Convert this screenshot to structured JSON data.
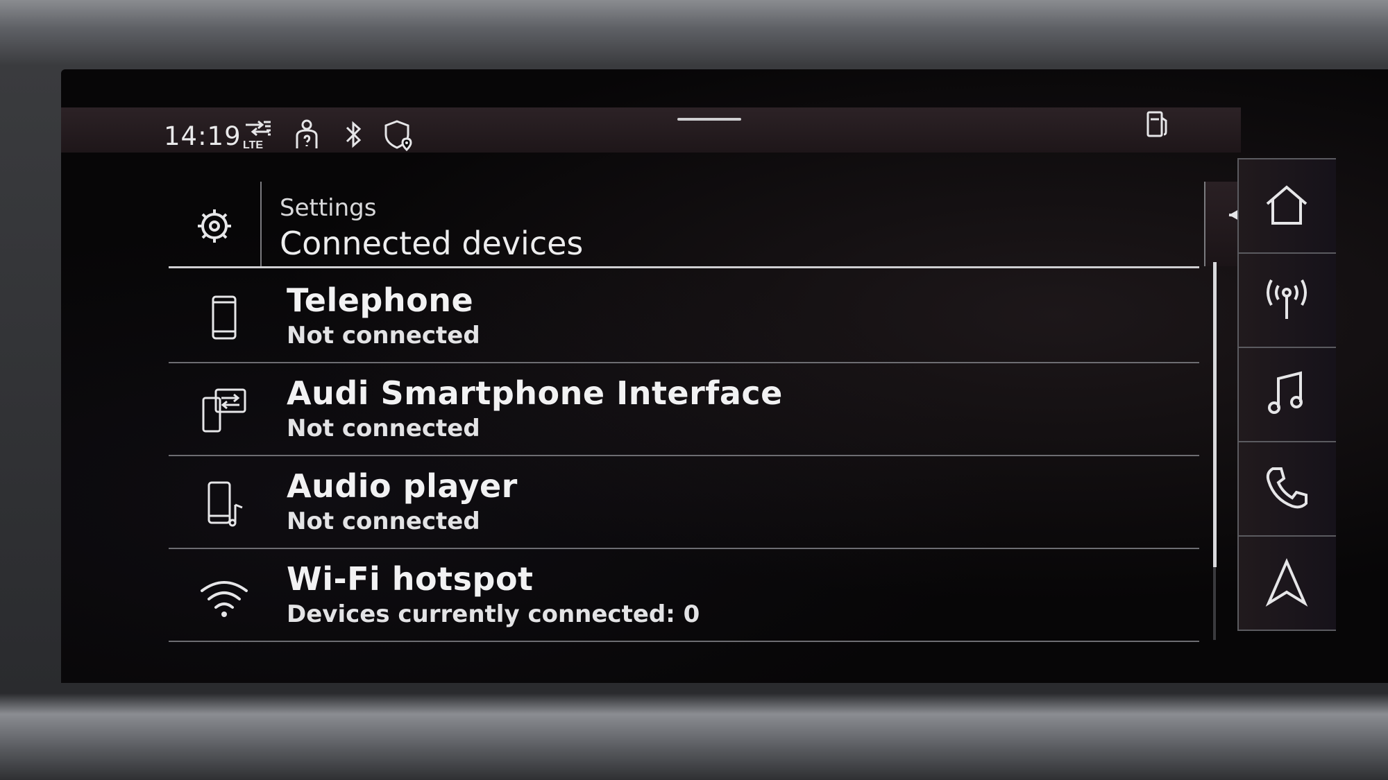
{
  "status_bar": {
    "time": "14:19",
    "icons": [
      "lte-signal-icon",
      "user-profile-icon",
      "bluetooth-icon",
      "privacy-location-icon",
      "fuel-icon"
    ]
  },
  "header": {
    "breadcrumb": "Settings",
    "title": "Connected devices",
    "icon": "gear-icon",
    "back_icon": "back-arrow-icon"
  },
  "devices": [
    {
      "icon": "phone-icon",
      "title": "Telephone",
      "status": "Not connected"
    },
    {
      "icon": "smartphone-interface-icon",
      "title": "Audi Smartphone Interface",
      "status": "Not connected"
    },
    {
      "icon": "audio-player-icon",
      "title": "Audio player",
      "status": "Not connected"
    },
    {
      "icon": "wifi-icon",
      "title": "Wi-Fi hotspot",
      "status": "Devices currently connected: 0"
    }
  ],
  "side_nav": [
    "home-icon",
    "radio-icon",
    "music-icon",
    "phone-call-icon",
    "navigation-icon"
  ],
  "colors": {
    "screen_bg": "#070607",
    "text": "#f2f2f3",
    "divider": "#6d6d72"
  }
}
